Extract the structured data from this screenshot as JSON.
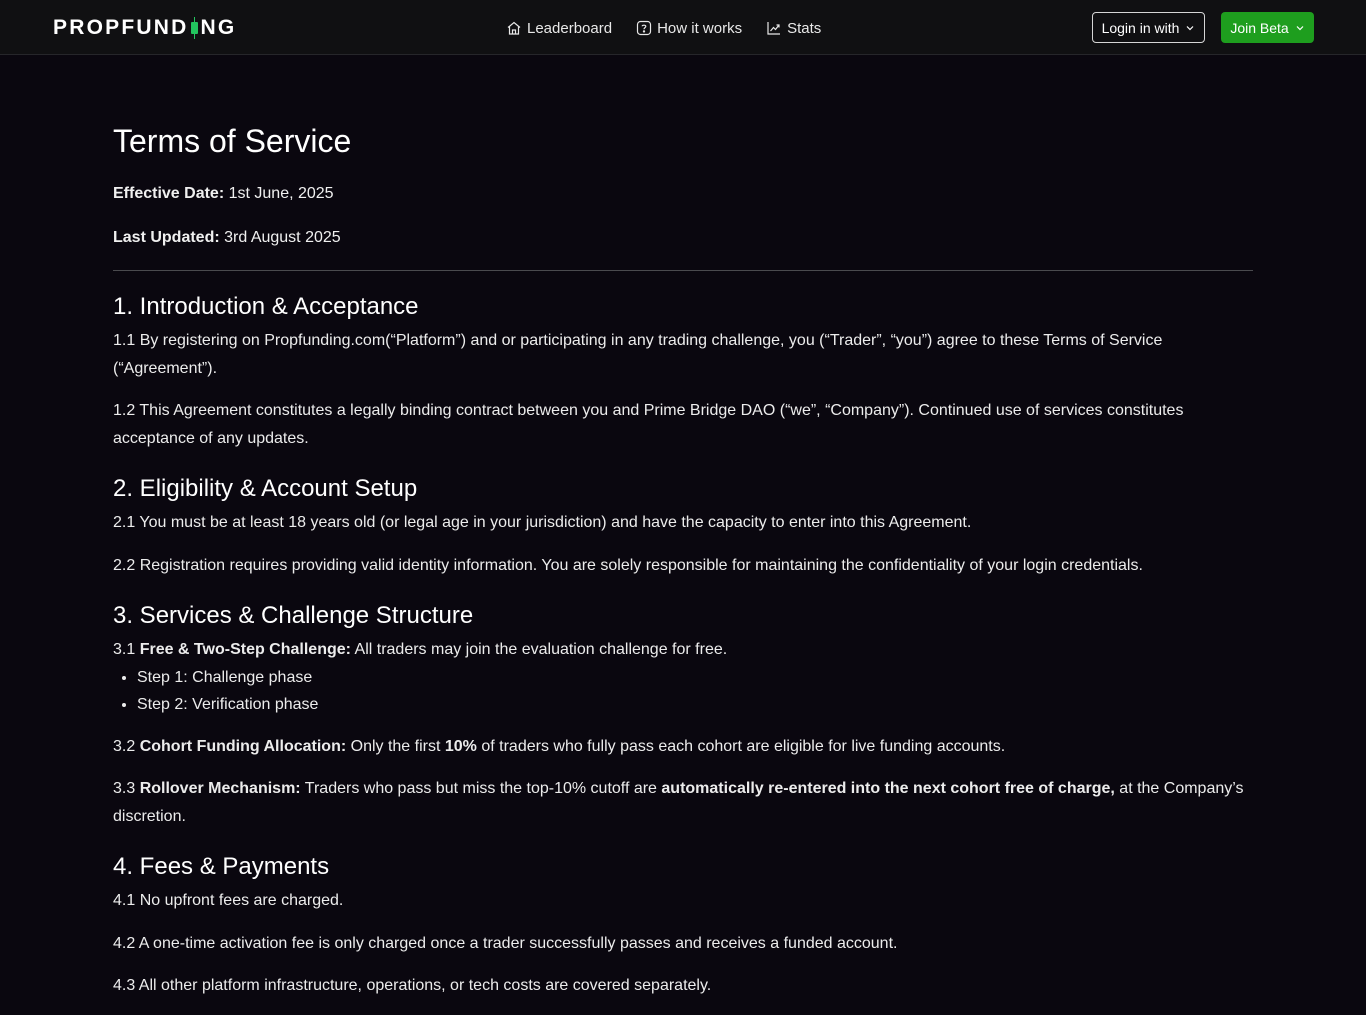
{
  "header": {
    "logo_left": "PROPFUND",
    "logo_right": "NG",
    "nav": [
      {
        "label": "Leaderboard",
        "icon": "home-icon"
      },
      {
        "label": "How it works",
        "icon": "question-icon"
      },
      {
        "label": "Stats",
        "icon": "chart-icon"
      }
    ],
    "login_label": "Login in with",
    "join_label": "Join Beta"
  },
  "colors": {
    "accent_green": "#1e9e1e",
    "logo_candle": "#22c55e",
    "background": "#0a070f"
  },
  "page": {
    "title": "Terms of Service",
    "effective_label": "Effective Date:",
    "effective_value": "1st June, 2025",
    "updated_label": "Last Updated:",
    "updated_value": "3rd August 2025"
  },
  "sections": {
    "s1": {
      "heading": "1. Introduction & Acceptance",
      "p1": "1.1 By registering on Propfunding.com(“Platform”) and or participating in any trading challenge, you (“Trader”, “you”) agree to these Terms of Service (“Agreement”).",
      "p2": "1.2 This Agreement constitutes a legally binding contract between you and Prime Bridge DAO (“we”, “Company”). Continued use of services constitutes acceptance of any updates."
    },
    "s2": {
      "heading": "2. Eligibility & Account Setup",
      "p1": "2.1 You must be at least 18 years old (or legal age in your jurisdiction) and have the capacity to enter into this Agreement.",
      "p2": "2.2 Registration requires providing valid identity information. You are solely responsible for maintaining the confidentiality of your login credentials."
    },
    "s3": {
      "heading": "3. Services & Challenge Structure",
      "p1_num": "3.1 ",
      "p1_bold": "Free & Two-Step Challenge:",
      "p1_rest": " All traders may join the evaluation challenge for free.",
      "steps": [
        "Step 1: Challenge phase",
        "Step 2: Verification phase"
      ],
      "p2_num": "3.2 ",
      "p2_bold": "Cohort Funding Allocation:",
      "p2_mid": " Only the first ",
      "p2_bold2": "10%",
      "p2_rest": " of traders who fully pass each cohort are eligible for live funding accounts.",
      "p3_num": "3.3 ",
      "p3_bold": "Rollover Mechanism:",
      "p3_mid": " Traders who pass but miss the top-10% cutoff are ",
      "p3_bold2": "automatically re-entered into the next cohort free of charge,",
      "p3_rest": " at the Company’s discretion."
    },
    "s4": {
      "heading": "4. Fees & Payments",
      "p1": "4.1 No upfront fees are charged.",
      "p2": "4.2 A one-time activation fee is only charged once a trader successfully passes and receives a funded account.",
      "p3": "4.3 All other platform infrastructure, operations, or tech costs are covered separately."
    }
  }
}
